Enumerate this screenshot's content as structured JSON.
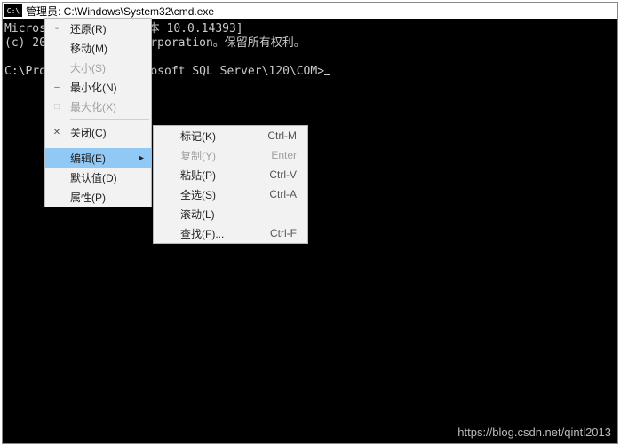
{
  "title": "管理员: C:\\Windows\\System32\\cmd.exe",
  "console": {
    "line1": "Microsoft Windows [版本 10.0.14393]",
    "line2": "(c) 2016 Microsoft Corporation。保留所有权利。",
    "line3": "",
    "prompt": "C:\\Program Files\\Microsoft SQL Server\\120\\COM>"
  },
  "menu1": {
    "restore": "还原(R)",
    "move": "移动(M)",
    "size": "大小(S)",
    "minimize": "最小化(N)",
    "maximize": "最大化(X)",
    "close": "关闭(C)",
    "edit": "编辑(E)",
    "defaults": "默认值(D)",
    "properties": "属性(P)"
  },
  "menu2": {
    "mark": {
      "label": "标记(K)",
      "shortcut": "Ctrl-M"
    },
    "copy": {
      "label": "复制(Y)",
      "shortcut": "Enter"
    },
    "paste": {
      "label": "粘贴(P)",
      "shortcut": "Ctrl-V"
    },
    "selectall": {
      "label": "全选(S)",
      "shortcut": "Ctrl-A"
    },
    "scroll": {
      "label": "滚动(L)",
      "shortcut": ""
    },
    "find": {
      "label": "查找(F)...",
      "shortcut": "Ctrl-F"
    }
  },
  "watermark": "https://blog.csdn.net/qintl2013"
}
